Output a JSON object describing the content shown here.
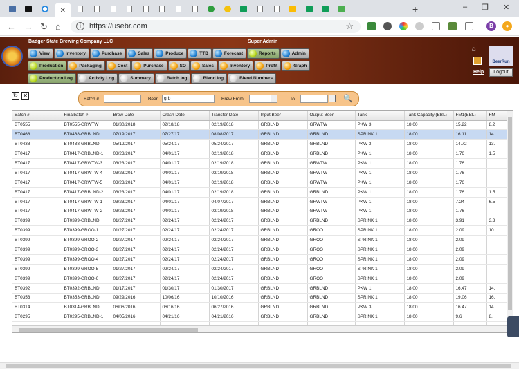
{
  "browser": {
    "url": "https://usebr.com",
    "tab_icons": [
      "grid-tab-icon",
      "s-tab-icon",
      "circle-tab-icon",
      "close-icon",
      "doc-tab-icon",
      "doc-tab-icon",
      "doc-tab-icon",
      "doc-tab-icon",
      "doc-tab-icon",
      "doc-tab-icon",
      "doc-tab-icon",
      "doc-tab-icon",
      "green-dot-tab-icon",
      "yellow-dot-tab-icon",
      "g-tab-icon",
      "doc-tab-icon",
      "doc-tab-icon",
      "drive-tab-icon",
      "sheets-tab-icon",
      "sheets-tab-icon",
      "h-tab-icon"
    ],
    "new_tab": "+",
    "avatar_letter": "B"
  },
  "header": {
    "company": "Badger State Brewing Company LLC",
    "role": "Super Admin",
    "help": "Help",
    "logout": "Logout",
    "logo_text": "BeerRun"
  },
  "menu_row1": [
    {
      "label": "View",
      "ball": "blue"
    },
    {
      "label": "Inventory",
      "ball": "blue"
    },
    {
      "label": "Purchase",
      "ball": "blue"
    },
    {
      "label": "Sales",
      "ball": "blue"
    },
    {
      "label": "Produce",
      "ball": "blue"
    },
    {
      "label": "TTB",
      "ball": "blue"
    },
    {
      "label": "Forecast",
      "ball": "blue"
    },
    {
      "label": "Reports",
      "ball": "green",
      "selected": true
    },
    {
      "label": "Admin",
      "ball": "blue"
    }
  ],
  "menu_row2": [
    {
      "label": "Production",
      "ball": "green",
      "selected": true
    },
    {
      "label": "Packaging",
      "ball": "orange"
    },
    {
      "label": "Cost",
      "ball": "orange"
    },
    {
      "label": "Purchase",
      "ball": "orange"
    },
    {
      "label": "SO",
      "ball": "orange"
    },
    {
      "label": "Sales",
      "ball": "orange"
    },
    {
      "label": "Inventory",
      "ball": "orange"
    },
    {
      "label": "Profit",
      "ball": "orange"
    },
    {
      "label": "Graph",
      "ball": "orange"
    }
  ],
  "menu_row3": [
    {
      "label": "Production Log",
      "ball": "green",
      "selected": true
    },
    {
      "label": "Activity Log",
      "ball": "white"
    },
    {
      "label": "Summary",
      "ball": "white"
    },
    {
      "label": "Batch log",
      "ball": "white"
    },
    {
      "label": "Blend log",
      "ball": "white"
    },
    {
      "label": "Blend Numbers",
      "ball": "white"
    }
  ],
  "filters": {
    "batch_label": "Batch #",
    "batch_value": "",
    "beer_label": "Beer",
    "beer_value": "grb",
    "brew_from_label": "Brew From",
    "brew_from_value": "",
    "to_label": "To",
    "to_value": ""
  },
  "table": {
    "columns": [
      "Batch #",
      "Finalbatch #",
      "Brew Date",
      "Crash Date",
      "Transfer Date",
      "Input Beer",
      "Output Beer",
      "Tank",
      "Tank Capacity (BBL)",
      "FM1(BBL)",
      "FM"
    ],
    "rows": [
      [
        "BT0555",
        "BT0555-GRWTW",
        "01/30/2018",
        "02/18/18",
        "02/19/2018",
        "GRBLND",
        "GRWTW",
        "PKW 3",
        "18.00",
        "15.22",
        "8.2"
      ],
      [
        "BT0468",
        "BT0468-GRBLND",
        "07/19/2017",
        "07/27/17",
        "08/08/2017",
        "GRBLND",
        "GRBLND",
        "SPRINK 1",
        "18.00",
        "16.11",
        "14."
      ],
      [
        "BT0438",
        "BT0438-GRBLND",
        "05/12/2017",
        "05/24/17",
        "05/24/2017",
        "GRBLND",
        "GRBLND",
        "PKW 3",
        "18.00",
        "14.72",
        "13."
      ],
      [
        "BT0417",
        "BT0417-GRBLND-1",
        "03/23/2017",
        "04/01/17",
        "02/19/2018",
        "GRBLND",
        "GRBLND",
        "PKW 1",
        "18.00",
        "1.76",
        "1.5"
      ],
      [
        "BT0417",
        "BT0417-GRWTW-3",
        "03/23/2017",
        "04/01/17",
        "02/19/2018",
        "GRBLND",
        "GRWTW",
        "PKW 1",
        "18.00",
        "1.76",
        ""
      ],
      [
        "BT0417",
        "BT0417-GRWTW-4",
        "03/23/2017",
        "04/01/17",
        "02/19/2018",
        "GRBLND",
        "GRWTW",
        "PKW 1",
        "18.00",
        "1.76",
        ""
      ],
      [
        "BT0417",
        "BT0417-GRWTW-5",
        "03/23/2017",
        "04/01/17",
        "02/19/2018",
        "GRBLND",
        "GRWTW",
        "PKW 1",
        "18.00",
        "1.76",
        ""
      ],
      [
        "BT0417",
        "BT0417-GRBLND-2",
        "03/23/2017",
        "04/01/17",
        "02/19/2018",
        "GRBLND",
        "GRBLND",
        "PKW 1",
        "18.00",
        "1.76",
        "1.5"
      ],
      [
        "BT0417",
        "BT0417-GRWTW-1",
        "03/23/2017",
        "04/01/17",
        "04/07/2017",
        "GRBLND",
        "GRWTW",
        "PKW 1",
        "18.00",
        "7.24",
        "6.5"
      ],
      [
        "BT0417",
        "BT0417-GRWTW-2",
        "03/23/2017",
        "04/01/17",
        "02/19/2018",
        "GRBLND",
        "GRWTW",
        "PKW 1",
        "18.00",
        "1.76",
        ""
      ],
      [
        "BT0399",
        "BT0399-GRBLND",
        "01/27/2017",
        "02/24/17",
        "02/24/2017",
        "GRBLND",
        "GRBLND",
        "SPRINK 1",
        "18.00",
        "3.91",
        "3.3"
      ],
      [
        "BT0399",
        "BT0399-GROO-1",
        "01/27/2017",
        "02/24/17",
        "02/24/2017",
        "GRBLND",
        "GROO",
        "SPRINK 1",
        "18.00",
        "2.09",
        "10."
      ],
      [
        "BT0399",
        "BT0399-GROO-2",
        "01/27/2017",
        "02/24/17",
        "02/24/2017",
        "GRBLND",
        "GROO",
        "SPRINK 1",
        "18.00",
        "2.09",
        ""
      ],
      [
        "BT0399",
        "BT0399-GROO-3",
        "01/27/2017",
        "02/24/17",
        "02/24/2017",
        "GRBLND",
        "GROO",
        "SPRINK 1",
        "18.00",
        "2.09",
        ""
      ],
      [
        "BT0399",
        "BT0399-GROO-4",
        "01/27/2017",
        "02/24/17",
        "02/24/2017",
        "GRBLND",
        "GROO",
        "SPRINK 1",
        "18.00",
        "2.09",
        ""
      ],
      [
        "BT0399",
        "BT0399-GROO-5",
        "01/27/2017",
        "02/24/17",
        "02/24/2017",
        "GRBLND",
        "GROO",
        "SPRINK 1",
        "18.00",
        "2.09",
        ""
      ],
      [
        "BT0399",
        "BT0399-GROO-6",
        "01/27/2017",
        "02/24/17",
        "02/24/2017",
        "GRBLND",
        "GROO",
        "SPRINK 1",
        "18.00",
        "2.09",
        ""
      ],
      [
        "BT0392",
        "BT0392-GRBLND",
        "01/17/2017",
        "01/30/17",
        "01/30/2017",
        "GRBLND",
        "GRBLND",
        "PKW 1",
        "18.00",
        "16.47",
        "14."
      ],
      [
        "BT0353",
        "BT0353-GRBLND",
        "09/29/2016",
        "10/06/16",
        "10/10/2016",
        "GRBLND",
        "GRBLND",
        "SPRINK 1",
        "18.00",
        "19.06",
        "16."
      ],
      [
        "BT0314",
        "BT0314-GRBLND",
        "06/06/2016",
        "06/16/16",
        "06/27/2016",
        "GRBLND",
        "GRBLND",
        "PKW 3",
        "18.00",
        "16.47",
        "14."
      ],
      [
        "BT0295",
        "BT0295-GRBLND-1",
        "04/05/2016",
        "04/21/16",
        "04/21/2016",
        "GRBLND",
        "GRBLND",
        "SPRINK 1",
        "18.00",
        "9.6",
        "8."
      ],
      [
        "",
        "",
        "",
        "",
        "",
        "",
        "",
        "",
        "",
        "",
        ""
      ]
    ],
    "selected_row": 1
  }
}
